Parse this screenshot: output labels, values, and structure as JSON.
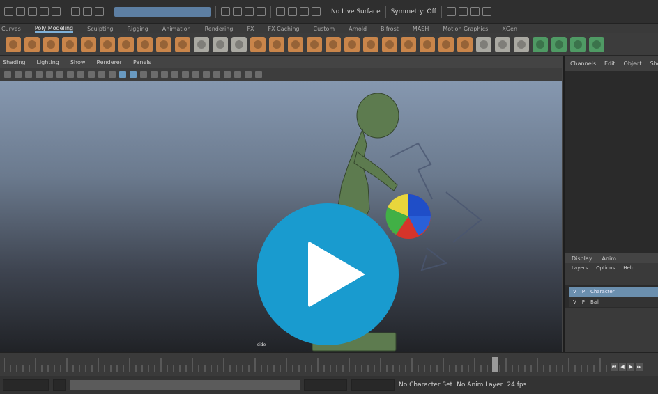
{
  "toolbar": {
    "live_surface": "No Live Surface",
    "symmetry": "Symmetry: Off"
  },
  "shelf_tabs": [
    "Curves",
    "Poly Modeling",
    "Sculpting",
    "Rigging",
    "Animation",
    "Rendering",
    "FX",
    "FX Caching",
    "Custom",
    "Arnold",
    "Bifrost",
    "MASH",
    "Motion Graphics",
    "XGen"
  ],
  "active_shelf_tab": "Poly Modeling",
  "panel_menu": [
    "Shading",
    "Lighting",
    "Show",
    "Renderer",
    "Panels"
  ],
  "camera_label": "side",
  "channel_box_tabs": [
    "Channels",
    "Edit",
    "Object",
    "Show"
  ],
  "layer_editor": {
    "tabs": [
      "Display",
      "Anim"
    ],
    "menu": [
      "Layers",
      "Options",
      "Help"
    ],
    "layers": [
      {
        "visible": "V",
        "playback": "P",
        "name": "Character"
      },
      {
        "visible": "V",
        "playback": "P",
        "name": "Ball"
      }
    ]
  },
  "range_slider": {
    "char_set": "No Character Set",
    "anim_layer": "No Anim Layer",
    "fps": "24 fps"
  },
  "colors": {
    "play_button": "#199bcf",
    "character": "#5d7b4f",
    "ball_red": "#d6342a",
    "ball_blue": "#1f4ec8",
    "ball_yellow": "#e8d63c",
    "ball_green": "#41b046"
  },
  "icons": [
    "play-icon"
  ]
}
